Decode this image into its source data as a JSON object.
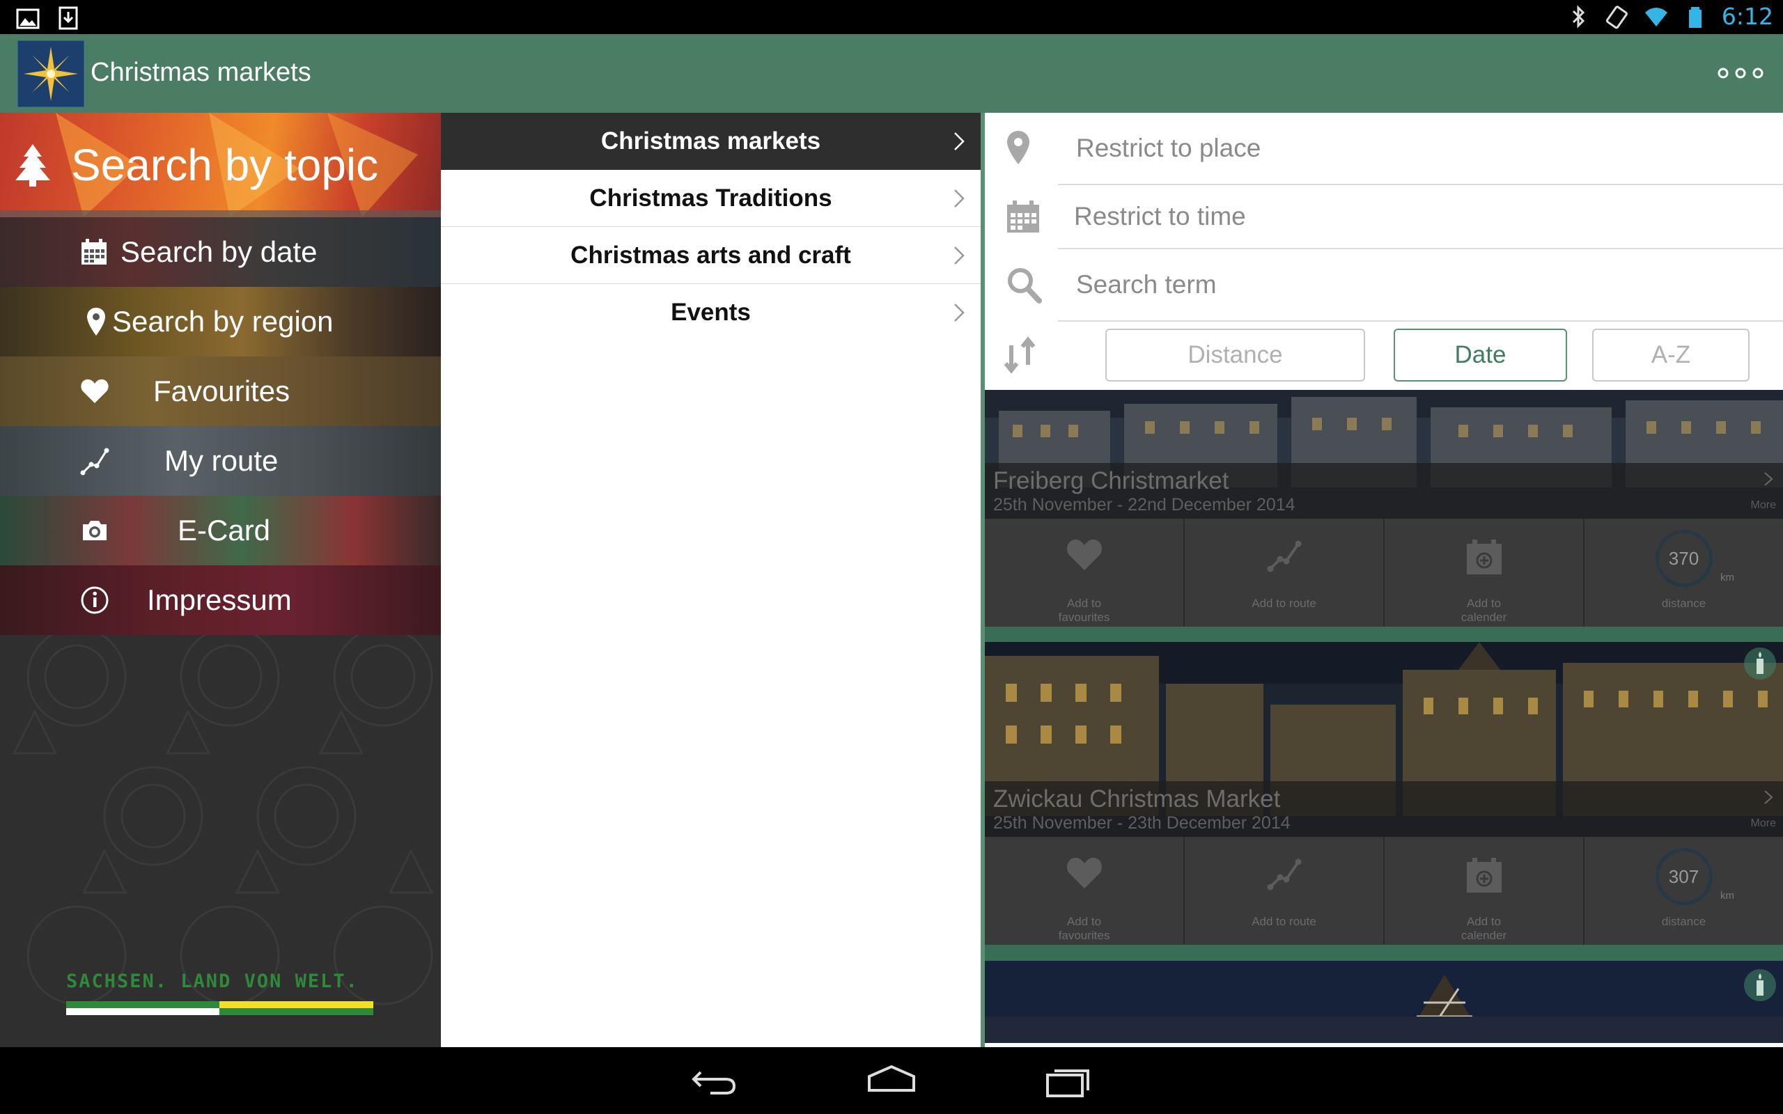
{
  "status_bar": {
    "time": "6:12"
  },
  "action_bar": {
    "title": "Christmas markets"
  },
  "left_nav": {
    "topic": "Search by topic",
    "items": [
      {
        "label": "Search by date",
        "icon": "calendar-icon"
      },
      {
        "label": "Search by region",
        "icon": "pin-icon"
      },
      {
        "label": "Favourites",
        "icon": "heart-icon"
      },
      {
        "label": "My route",
        "icon": "route-icon"
      },
      {
        "label": "E-Card",
        "icon": "camera-icon"
      },
      {
        "label": "Impressum",
        "icon": "info-icon"
      }
    ],
    "slogan": "SACHSEN. LAND VON WELT."
  },
  "middle_list": {
    "items": [
      {
        "label": "Christmas markets",
        "active": true
      },
      {
        "label": "Christmas Traditions",
        "active": false
      },
      {
        "label": "Christmas arts and craft",
        "active": false
      },
      {
        "label": "Events",
        "active": false
      }
    ]
  },
  "filters": {
    "place": "Restrict to place",
    "time": "Restrict to time",
    "term": "Search term"
  },
  "sort": {
    "options": [
      "Distance",
      "Date",
      "A-Z"
    ],
    "selected": "Date"
  },
  "results": [
    {
      "title": "Freiberg Christmarket",
      "dates": "25th November - 22nd December 2014",
      "more": "More",
      "actions": {
        "favourite": "Add to favourites",
        "route": "Add to route",
        "calendar": "Add to calender"
      },
      "distance_value": "370",
      "distance_unit": "km",
      "distance_label": "distance"
    },
    {
      "title": "Zwickau Christmas Market",
      "dates": "25th November - 23th December 2014",
      "more": "More",
      "actions": {
        "favourite": "Add to favourites",
        "route": "Add to route",
        "calendar": "Add to calender"
      },
      "distance_value": "307",
      "distance_unit": "km",
      "distance_label": "distance"
    }
  ],
  "colors": {
    "action_bar": "#4a7d63",
    "accent": "#3f7d62",
    "status_time": "#33b5e5"
  }
}
